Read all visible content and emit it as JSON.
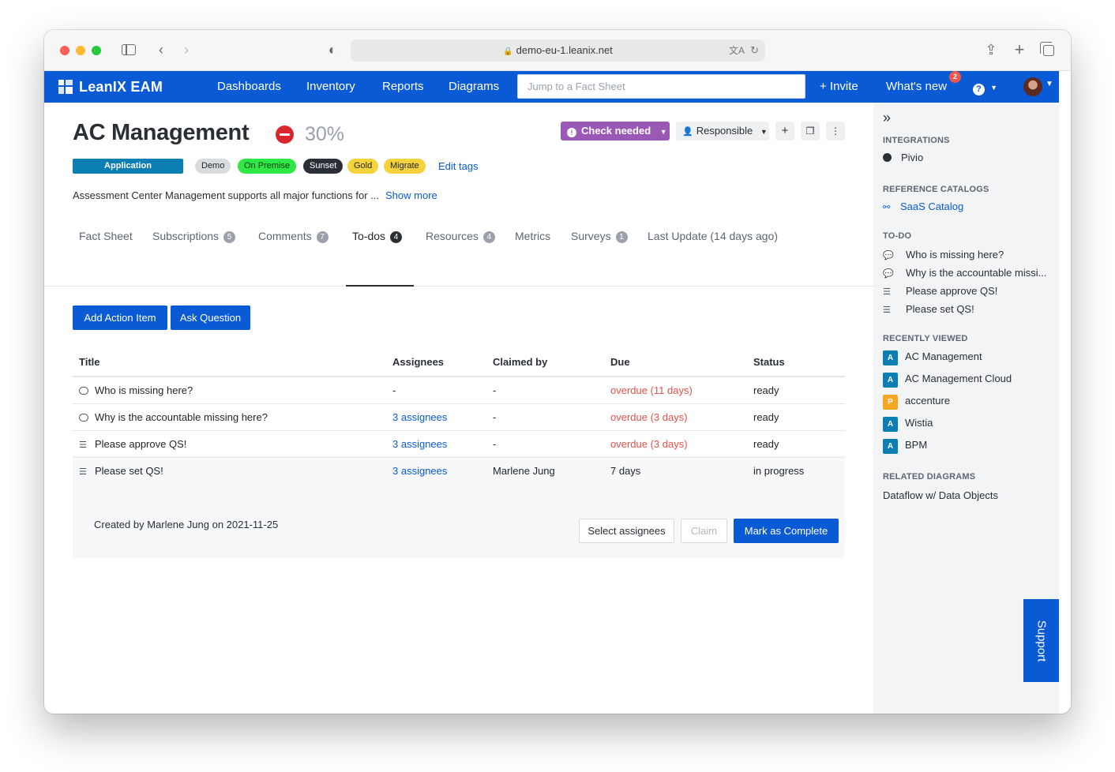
{
  "browser": {
    "url": "demo-eu-1.leanix.net"
  },
  "nav": {
    "brand": "LeanIX EAM",
    "links": [
      "Dashboards",
      "Inventory",
      "Reports",
      "Diagrams"
    ],
    "search_placeholder": "Jump to a Fact Sheet",
    "invite": "+ Invite",
    "whats_new": "What's new",
    "whats_new_count": "2",
    "help": "?"
  },
  "factsheet": {
    "title": "AC Management",
    "completion": "30%",
    "status_button": "Check needed",
    "responsible_button": "Responsible",
    "type": "Application",
    "tags": [
      {
        "label": "Demo",
        "bg": "#d9dcdf",
        "fg": "#1f2328"
      },
      {
        "label": "On Premise",
        "bg": "#2ee846",
        "fg": "#0f3d16"
      },
      {
        "label": "Sunset",
        "bg": "#2a2f36",
        "fg": "#ffffff"
      },
      {
        "label": "Gold",
        "bg": "#f5d33c",
        "fg": "#1f2328"
      },
      {
        "label": "Migrate",
        "bg": "#f5d33c",
        "fg": "#1f2328"
      }
    ],
    "edit_tags": "Edit tags",
    "description": "Assessment Center Management supports all major functions for ...",
    "show_more": "Show more"
  },
  "tabs": [
    {
      "label": "Fact Sheet",
      "count": ""
    },
    {
      "label": "Subscriptions",
      "count": "5"
    },
    {
      "label": "Comments",
      "count": "7"
    },
    {
      "label": "To-dos",
      "count": "4"
    },
    {
      "label": "Resources",
      "count": "4"
    },
    {
      "label": "Metrics",
      "count": ""
    },
    {
      "label": "Surveys",
      "count": "1"
    },
    {
      "label": "Last Update (14 days ago)",
      "count": ""
    }
  ],
  "actions": {
    "add_action_item": "Add Action Item",
    "ask_question": "Ask Question"
  },
  "todo_table": {
    "headers": [
      "Title",
      "Assignees",
      "Claimed by",
      "Due",
      "Status"
    ],
    "rows": [
      {
        "icon": "comment-icon",
        "title": "Who is missing here?",
        "assignees": "-",
        "claimed_by": "-",
        "due": "overdue (11 days)",
        "status": "ready"
      },
      {
        "icon": "comment-icon",
        "title": "Why is the accountable missing here?",
        "assignees": "3 assignees",
        "claimed_by": "-",
        "due": "overdue (3 days)",
        "status": "ready"
      },
      {
        "icon": "checklist-icon",
        "title": "Please approve QS!",
        "assignees": "3 assignees",
        "claimed_by": "-",
        "due": "overdue (3 days)",
        "status": "ready"
      },
      {
        "icon": "checklist-icon",
        "title": "Please set QS!",
        "assignees": "3 assignees",
        "claimed_by": "Marlene Jung",
        "due": "7 days",
        "status": "in progress"
      }
    ],
    "expanded": {
      "created": "Created by Marlene Jung on 2021-11-25",
      "select_assignees": "Select assignees",
      "claim": "Claim",
      "mark_complete": "Mark as Complete"
    }
  },
  "right_panel": {
    "integrations_heading": "INTEGRATIONS",
    "integrations": [
      "Pivio"
    ],
    "catalogs_heading": "REFERENCE CATALOGS",
    "catalogs": [
      "SaaS Catalog"
    ],
    "todo_heading": "TO-DO",
    "todos": [
      "Who is missing here?",
      "Why is the accountable missi...",
      "Please approve QS!",
      "Please set QS!"
    ],
    "recent_heading": "RECENTLY VIEWED",
    "recent": [
      {
        "type": "A",
        "label": "AC Management"
      },
      {
        "type": "A",
        "label": "AC Management Cloud"
      },
      {
        "type": "P",
        "label": "accenture"
      },
      {
        "type": "A",
        "label": "Wistia"
      },
      {
        "type": "A",
        "label": "BPM"
      }
    ],
    "diagrams_heading": "RELATED DIAGRAMS",
    "diagrams": [
      "Dataflow w/ Data Objects"
    ]
  },
  "support": "Support"
}
